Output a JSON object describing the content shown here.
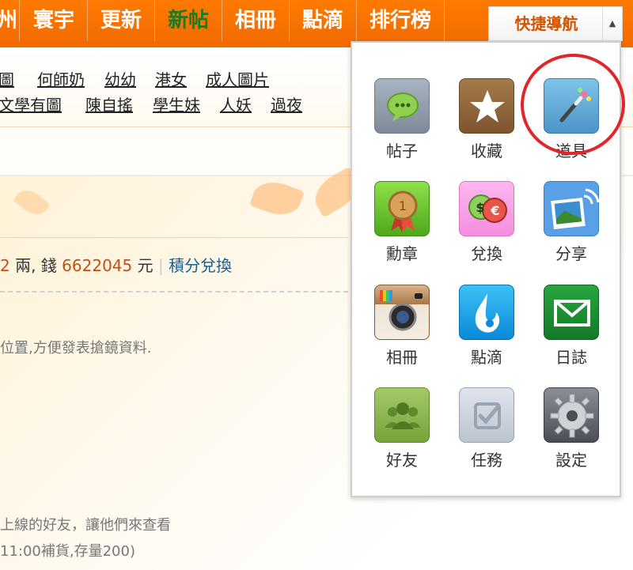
{
  "nav": {
    "items": [
      {
        "label": "州",
        "active": false
      },
      {
        "label": "寰宇",
        "active": false
      },
      {
        "label": "更新",
        "active": false
      },
      {
        "label": "新帖",
        "active": true
      },
      {
        "label": "相冊",
        "active": false
      },
      {
        "label": "點滴",
        "active": false
      },
      {
        "label": "排行榜",
        "active": false
      }
    ],
    "quick_nav": "快捷導航"
  },
  "tags": {
    "row1": [
      "圖",
      "何師奶",
      "幼幼",
      "港女",
      "成人圖片"
    ],
    "row2": [
      "文學有圖",
      "陳自搖",
      "學生妹",
      "人妖",
      "過夜"
    ]
  },
  "account": {
    "prefix": "2",
    "unit1": "兩, 錢",
    "money": "6622045",
    "unit2": "元",
    "separator": "|",
    "exchange_link": "積分兌換"
  },
  "notices": {
    "line1": "位置,方便發表搶鏡資料.",
    "line2": "上線的好友，讓他們來查看",
    "line3": "11:00補貨,存量200)"
  },
  "menu": {
    "items": [
      {
        "label": "帖子",
        "icon": "speech-bubble-icon"
      },
      {
        "label": "收藏",
        "icon": "star-icon"
      },
      {
        "label": "道具",
        "icon": "magic-wand-icon"
      },
      {
        "label": "勳章",
        "icon": "medal-icon"
      },
      {
        "label": "兌換",
        "icon": "currency-exchange-icon"
      },
      {
        "label": "分享",
        "icon": "share-photo-icon"
      },
      {
        "label": "相冊",
        "icon": "camera-icon"
      },
      {
        "label": "點滴",
        "icon": "flame-drop-icon"
      },
      {
        "label": "日誌",
        "icon": "envelope-icon"
      },
      {
        "label": "好友",
        "icon": "friends-icon"
      },
      {
        "label": "任務",
        "icon": "task-check-icon"
      },
      {
        "label": "設定",
        "icon": "gear-icon"
      }
    ]
  },
  "colors": {
    "nav_bg": "#f06a00",
    "accent_link": "#1c5c8a",
    "money_text": "#c0501a",
    "annotation_red": "#e0262a"
  }
}
